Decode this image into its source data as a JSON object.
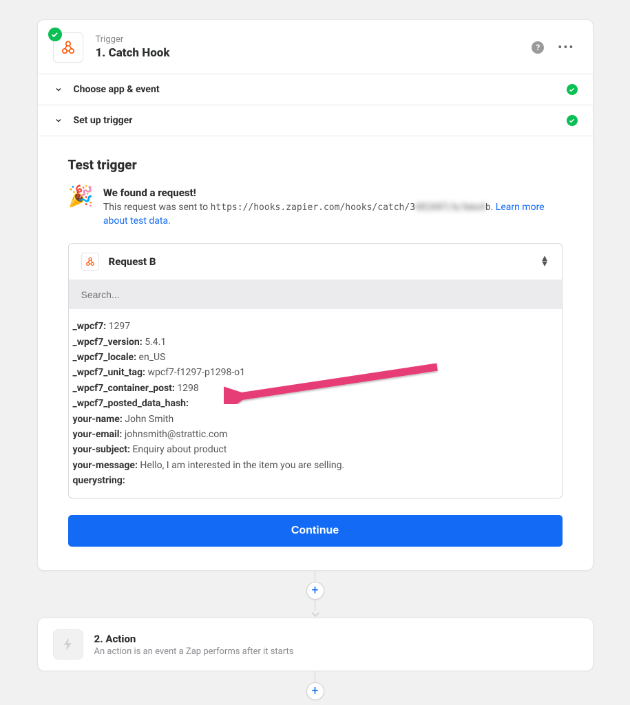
{
  "trigger": {
    "sub": "Trigger",
    "title": "1. Catch Hook"
  },
  "sections": {
    "choose": "Choose app & event",
    "setup": "Set up trigger"
  },
  "test": {
    "title": "Test trigger",
    "found_title": "We found a request!",
    "found_prefix": "This request was sent to ",
    "url_visible1": "https://hooks.zapier.com/hooks/catch/3",
    "url_hidden": "481607/b/bmo4",
    "url_visible2": "b",
    "found_suffix1": ". ",
    "learn_link": "Learn more about test data",
    "found_suffix2": "."
  },
  "request": {
    "label": "Request B",
    "search_placeholder": "Search...",
    "fields": [
      {
        "k": "_wpcf7:",
        "v": " 1297"
      },
      {
        "k": "_wpcf7_version:",
        "v": " 5.4.1"
      },
      {
        "k": "_wpcf7_locale:",
        "v": " en_US"
      },
      {
        "k": "_wpcf7_unit_tag:",
        "v": " wpcf7-f1297-p1298-o1"
      },
      {
        "k": "_wpcf7_container_post:",
        "v": " 1298"
      },
      {
        "k": "_wpcf7_posted_data_hash:",
        "v": ""
      },
      {
        "k": "your-name:",
        "v": " John Smith"
      },
      {
        "k": "your-email:",
        "v": " johnsmith@strattic.com"
      },
      {
        "k": "your-subject:",
        "v": " Enquiry about product"
      },
      {
        "k": "your-message:",
        "v": " Hello, I am interested in the item you are selling."
      },
      {
        "k": "querystring:",
        "v": ""
      }
    ]
  },
  "continue": "Continue",
  "action": {
    "title": "2. Action",
    "sub": "An action is an event a Zap performs after it starts"
  }
}
